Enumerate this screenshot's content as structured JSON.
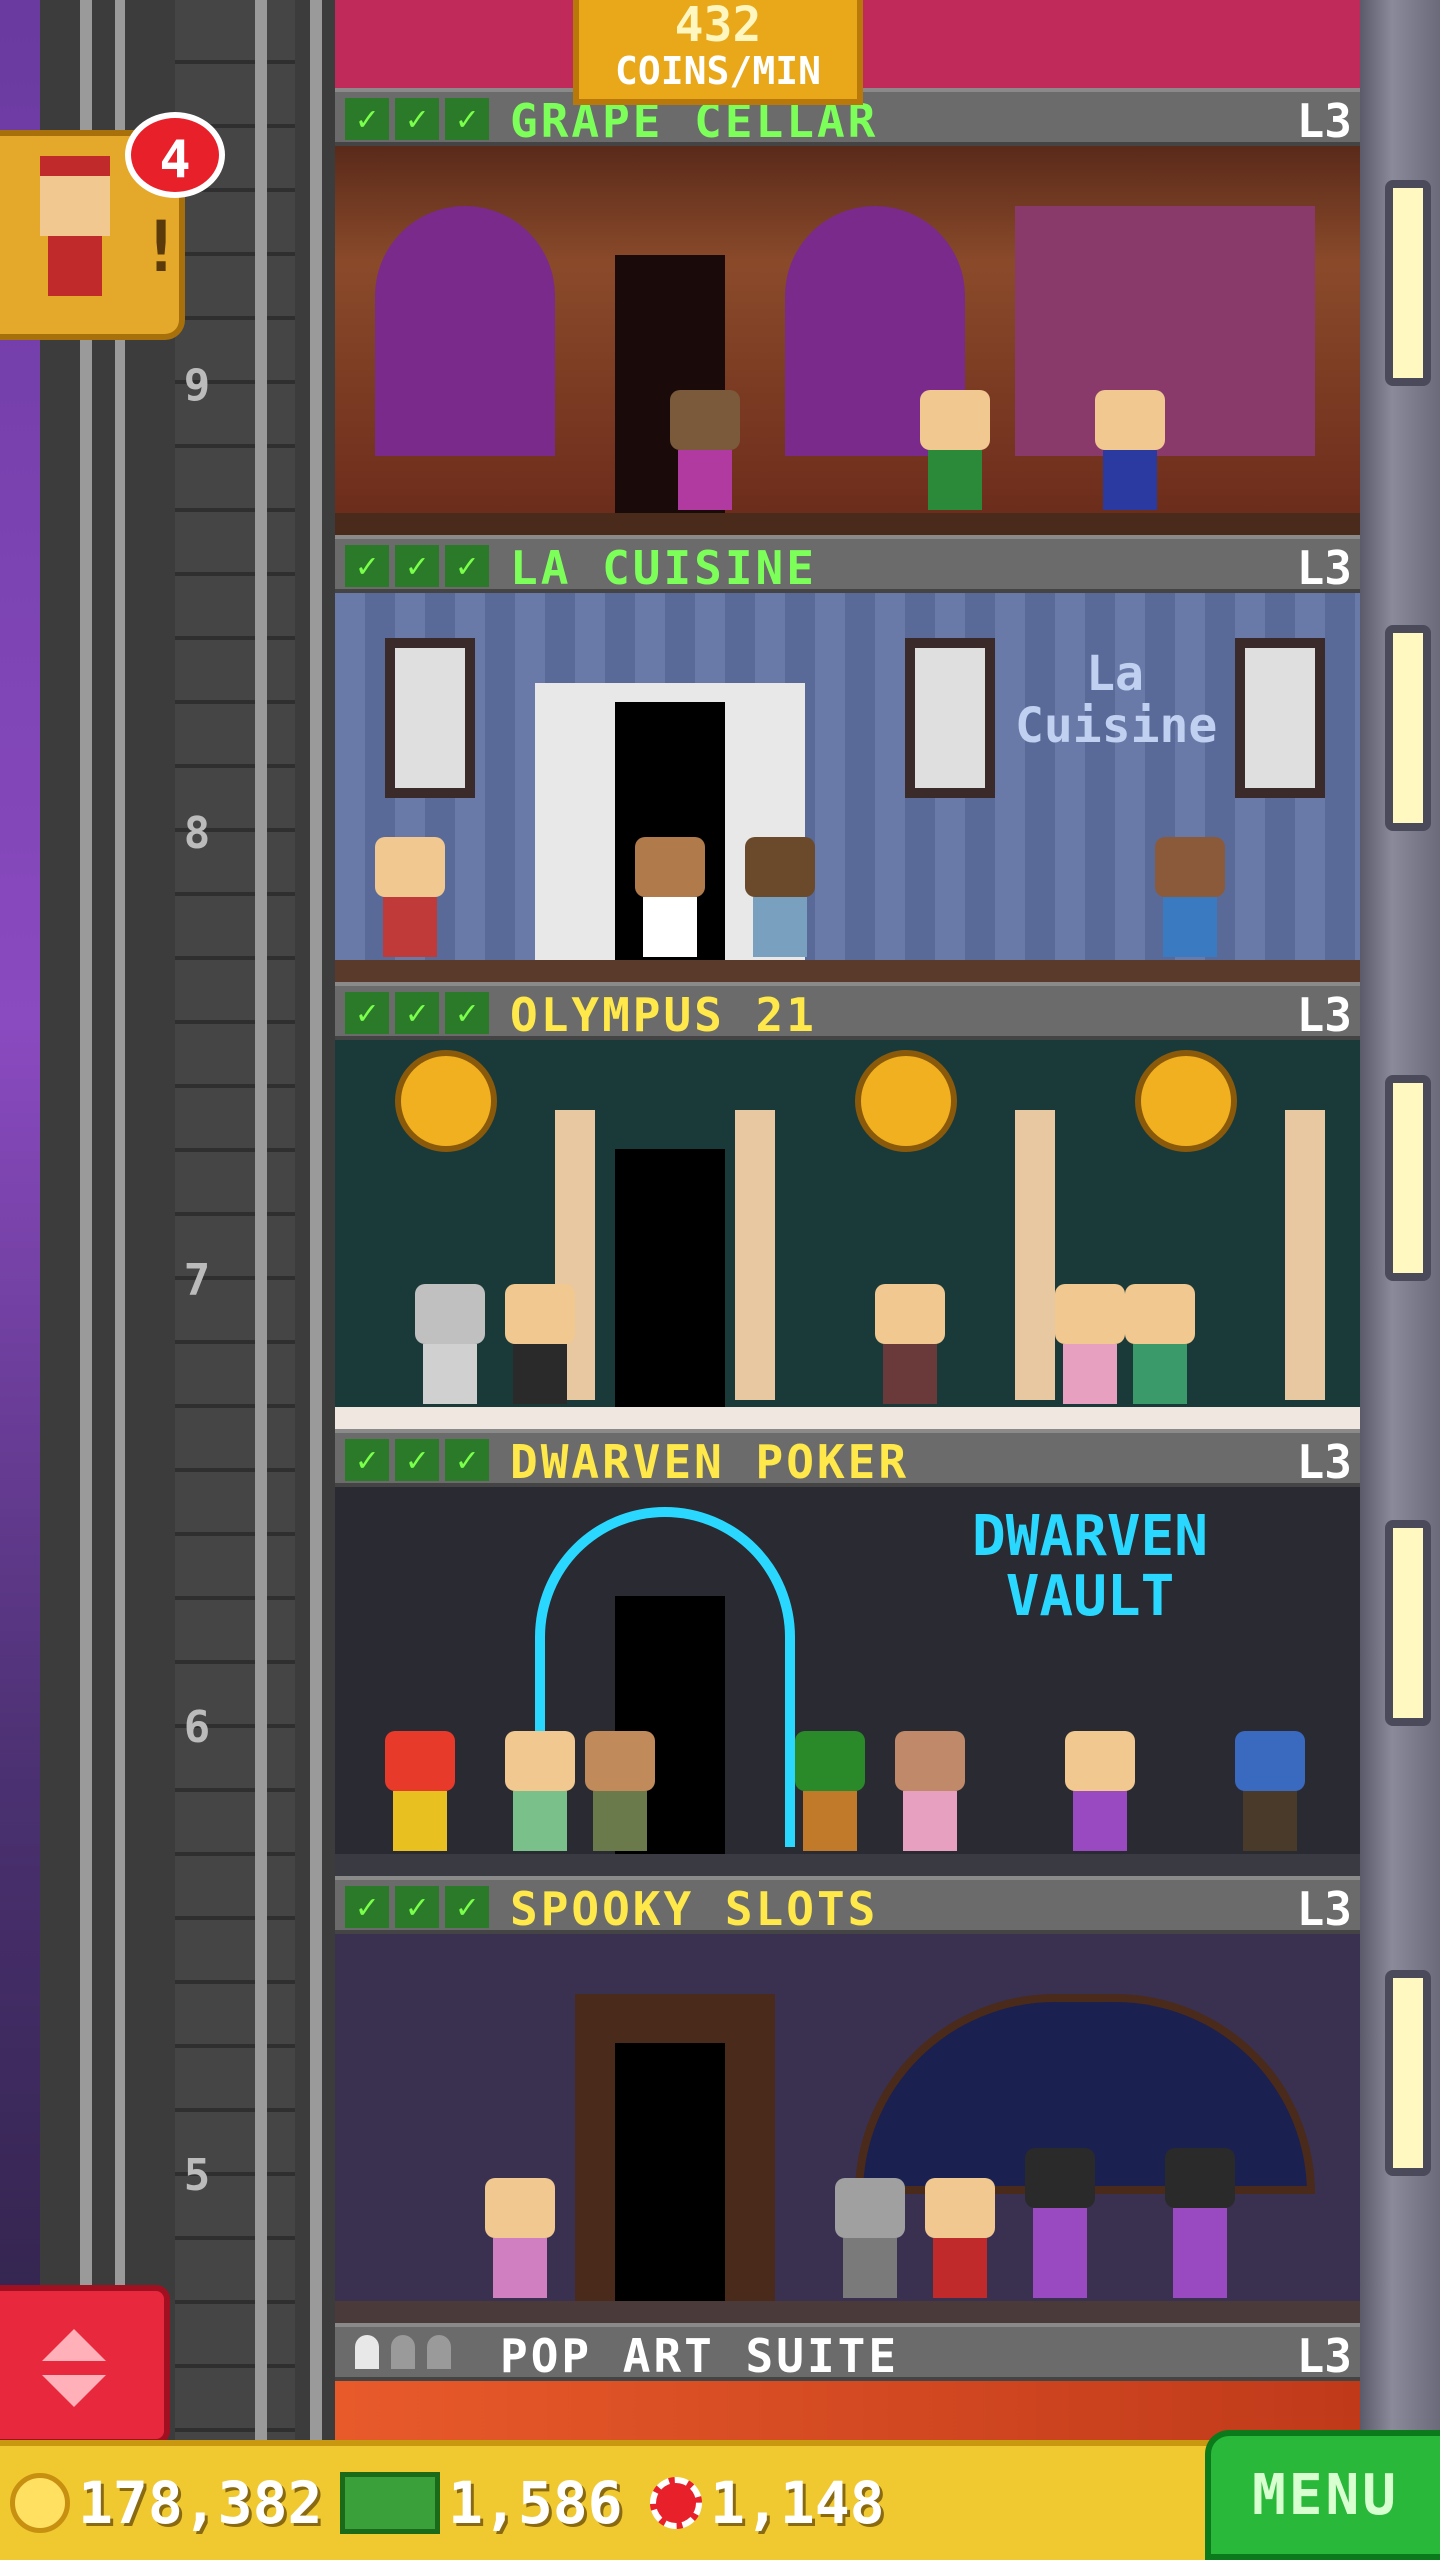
{
  "hud": {
    "coin_rate_value": "432",
    "coin_rate_unit": "COINS/MIN"
  },
  "visitor": {
    "badge_count": "4",
    "alert_mark": "!"
  },
  "floors": [
    {
      "number": "9",
      "name": "GRAPE CELLAR",
      "level": "L3",
      "checks": [
        "✓",
        "✓",
        "✓"
      ],
      "name_color": "#7dff5a"
    },
    {
      "number": "8",
      "name": "LA CUISINE",
      "level": "L3",
      "checks": [
        "✓",
        "✓",
        "✓"
      ],
      "name_color": "#7dff5a"
    },
    {
      "number": "7",
      "name": "OLYMPUS 21",
      "level": "L3",
      "checks": [
        "✓",
        "✓",
        "✓"
      ],
      "name_color": "#ffe84a"
    },
    {
      "number": "6",
      "name": "DWARVEN POKER",
      "level": "L3",
      "checks": [
        "✓",
        "✓",
        "✓"
      ],
      "name_color": "#ffe84a"
    },
    {
      "number": "5",
      "name": "SPOOKY SLOTS",
      "level": "L3",
      "checks": [
        "✓",
        "✓",
        "✓"
      ],
      "name_color": "#ffe84a"
    },
    {
      "number": "",
      "name": "POP ART SUITE",
      "level": "L3",
      "checks": [],
      "name_color": "#ffffff"
    }
  ],
  "signs": {
    "la_cuisine": "La Cuisine",
    "dwarven_vault": "DWARVEN VAULT"
  },
  "bottom_bar": {
    "coins": "178,382",
    "bux": "1,586",
    "chips": "1,148",
    "menu_label": "MENU"
  },
  "colors": {
    "check_green": "#7aff4a",
    "gold": "#f0c830",
    "menu_green": "#2ab83a",
    "elevator_red": "#e8283c"
  },
  "icons": [
    "coin-icon",
    "bux-icon",
    "chip-icon",
    "check-icon",
    "arrow-up-icon",
    "arrow-down-icon"
  ]
}
